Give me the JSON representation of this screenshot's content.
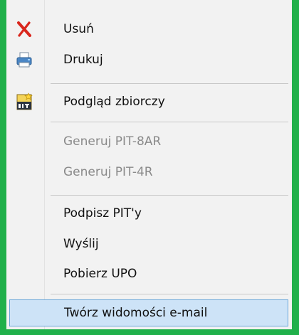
{
  "menu": {
    "items": [
      {
        "label": "Usuń",
        "icon": "delete-x-icon",
        "enabled": true
      },
      {
        "label": "Drukuj",
        "icon": "printer-icon",
        "enabled": true
      },
      {
        "label": "Podgląd zbiorczy",
        "icon": "pit-document-icon",
        "enabled": true
      },
      {
        "label": "Generuj PIT-8AR",
        "icon": "",
        "enabled": false
      },
      {
        "label": "Generuj PIT-4R",
        "icon": "",
        "enabled": false
      },
      {
        "label": "Podpisz PIT'y",
        "icon": "",
        "enabled": true
      },
      {
        "label": "Wyślij",
        "icon": "",
        "enabled": true
      },
      {
        "label": "Pobierz UPO",
        "icon": "",
        "enabled": true
      },
      {
        "label": "Twórz widomości e-mail",
        "icon": "",
        "enabled": true,
        "highlighted": true
      }
    ]
  },
  "colors": {
    "frame_border": "#20b04a",
    "highlight_bg": "#cde3f7",
    "highlight_border": "#6aa7da",
    "disabled_text": "#8a8a8a",
    "delete_icon": "#d9261c"
  }
}
